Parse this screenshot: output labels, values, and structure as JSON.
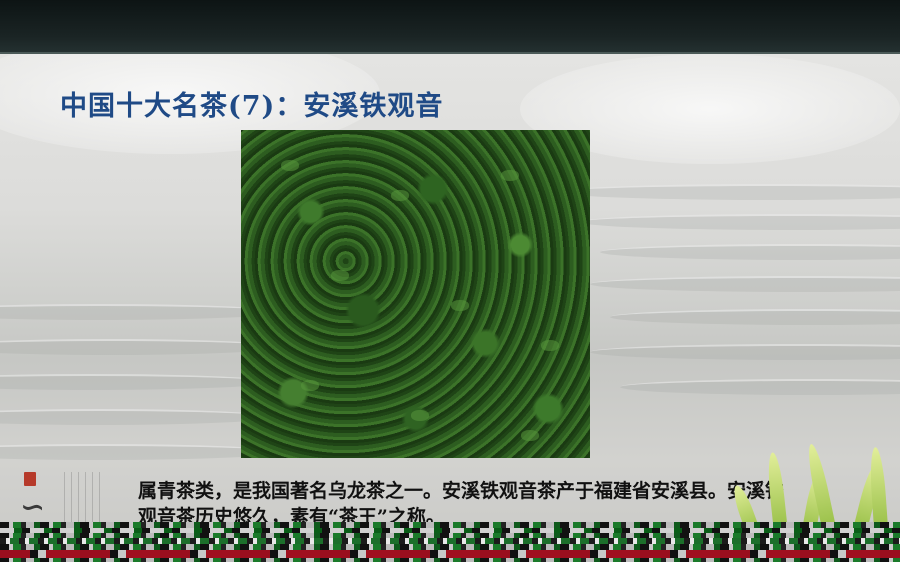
{
  "slide": {
    "title": "中国十大名茶(7)：安溪铁观音",
    "body": "属青茶类，是我国著名乌龙茶之一。安溪铁观音茶产于福建省安溪县。安溪铁观音茶历史悠久，素有“茶王”之称。"
  },
  "image": {
    "subject": "tieguanyin-tea-leaves-photo"
  },
  "decor": {
    "calligraphy_icon": "tea-calligraphy-icon",
    "seal_icon": "red-seal-icon",
    "accent_color": "#1f4a86"
  }
}
